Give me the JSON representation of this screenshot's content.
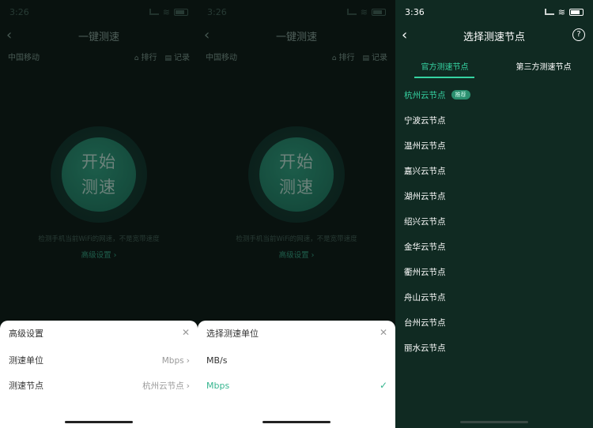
{
  "screens": [
    {
      "time": "3:26",
      "title": "一键测速",
      "carrier": "中国移动",
      "rank": "排行",
      "record": "记录",
      "start_line1": "开始",
      "start_line2": "测速",
      "hint": "检测手机当前WiFi的网速，不是宽带速度",
      "advanced": "高级设置 ›",
      "sheet": {
        "title": "高级设置",
        "rows": [
          {
            "label": "测速单位",
            "value": "Mbps"
          },
          {
            "label": "测速节点",
            "value": "杭州云节点"
          }
        ]
      }
    },
    {
      "time": "3:26",
      "title": "一键测速",
      "carrier": "中国移动",
      "rank": "排行",
      "record": "记录",
      "start_line1": "开始",
      "start_line2": "测速",
      "hint": "检测手机当前WiFi的网速，不是宽带速度",
      "advanced": "高级设置 ›",
      "sheet": {
        "title": "选择测速单位",
        "rows": [
          {
            "label": "MB/s"
          },
          {
            "label": "Mbps"
          }
        ]
      }
    },
    {
      "time": "3:36",
      "title": "选择测速节点",
      "tabs": [
        "官方测速节点",
        "第三方测速节点"
      ],
      "badge": "推荐",
      "nodes": [
        "杭州云节点",
        "宁波云节点",
        "温州云节点",
        "嘉兴云节点",
        "湖州云节点",
        "绍兴云节点",
        "金华云节点",
        "衢州云节点",
        "舟山云节点",
        "台州云节点",
        "丽水云节点"
      ]
    }
  ]
}
